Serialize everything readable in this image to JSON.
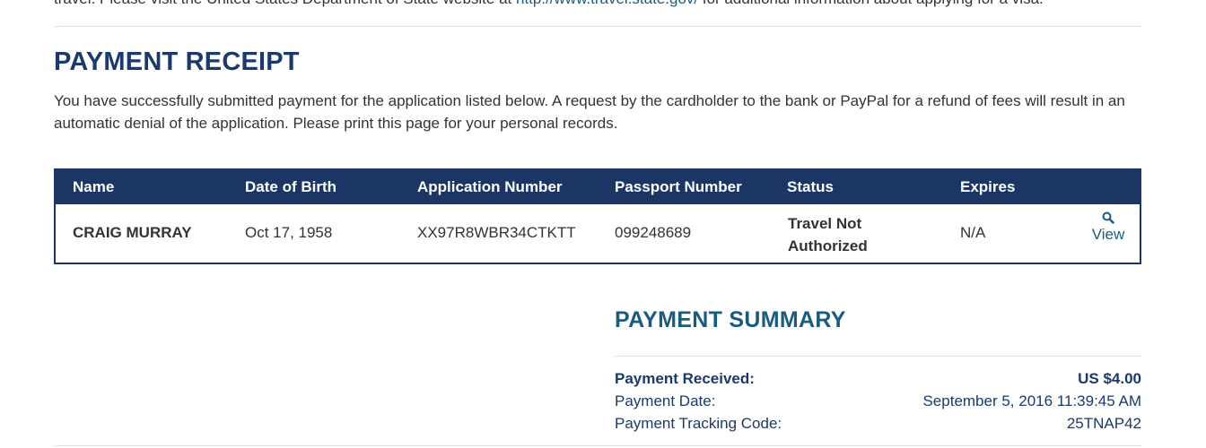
{
  "top_note": {
    "text_before": "travel. Please visit the United States Department of State website at ",
    "link": "http://www.travel.state.gov/",
    "text_after": " for additional information about applying for a visa."
  },
  "receipt": {
    "title": "PAYMENT RECEIPT",
    "intro": "You have successfully submitted payment for the application listed below. A request by the cardholder to the bank or PayPal for a refund of fees will result in an automatic denial of the application. Please print this page for your personal records."
  },
  "table": {
    "headers": [
      "Name",
      "Date of Birth",
      "Application Number",
      "Passport Number",
      "Status",
      "Expires"
    ],
    "row": {
      "name": "CRAIG MURRAY",
      "dob": "Oct 17, 1958",
      "application_number": "XX97R8WBR34CTKTT",
      "passport_number": "099248689",
      "status_line1": "Travel Not",
      "status_line2": "Authorized",
      "expires": "N/A",
      "view_label": "View",
      "view_icon": "magnifier-icon"
    }
  },
  "summary": {
    "title": "PAYMENT SUMMARY",
    "payment_received_label": "Payment Received:",
    "payment_received_value": "US $4.00",
    "payment_date_label": "Payment Date:",
    "payment_date_value": "September 5, 2016 11:39:45 AM",
    "tracking_label": "Payment Tracking Code:",
    "tracking_value": "25TNAP42"
  },
  "colors": {
    "navy": "#1b3664",
    "heading": "#1b3a6b",
    "link": "#1a5c7f"
  }
}
